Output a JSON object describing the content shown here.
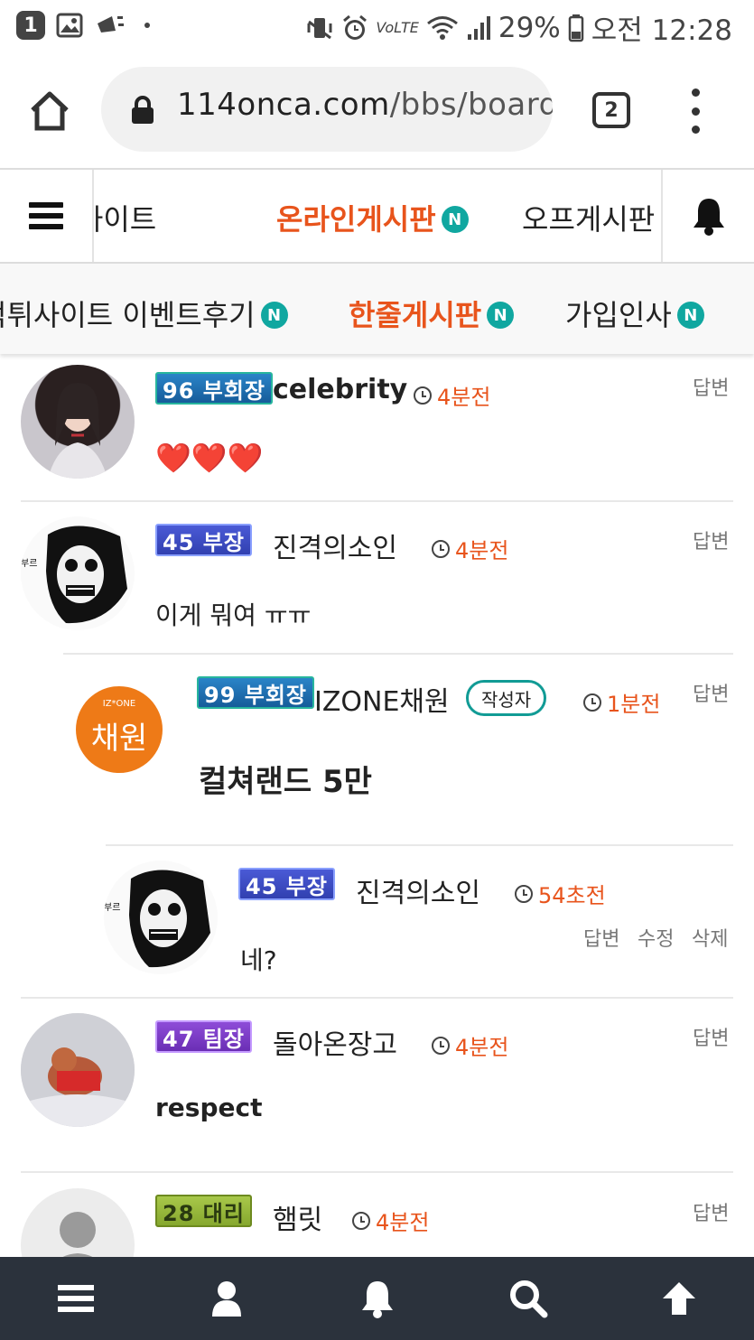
{
  "status_bar": {
    "notification_count": "1",
    "volte_label": "VoLTE",
    "battery": "29%",
    "time": "오전 12:28"
  },
  "browser": {
    "url_host": "114onca.com",
    "url_path": "/bbs/board",
    "tab_count": "2"
  },
  "nav_primary": {
    "items": [
      {
        "label": "먹튀사이트",
        "active": false,
        "new": false
      },
      {
        "label": "온라인게시판",
        "active": true,
        "new": true
      },
      {
        "label": "오프게시판",
        "active": false,
        "new": false
      }
    ],
    "new_badge": "N"
  },
  "nav_secondary": {
    "items": [
      {
        "label": "먹튀사이트 이벤트후기",
        "active": false,
        "new": true
      },
      {
        "label": "한줄게시판",
        "active": true,
        "new": true
      },
      {
        "label": "가입인사",
        "active": false,
        "new": true
      }
    ]
  },
  "comments": [
    {
      "level": "96 부회장",
      "level_color": "#1d6fae",
      "nickname": "celebrity",
      "time": "4분전",
      "text": "❤️❤️❤️",
      "reply": "답변"
    },
    {
      "level": "45 부장",
      "level_color": "#3d4fc7",
      "nickname": "진격의소인",
      "time": "4분전",
      "text": "이게 뭐여 ㅠㅠ",
      "reply": "답변"
    },
    {
      "level": "99 부회장",
      "level_color": "#1d6fae",
      "nickname": "IZONE채원",
      "author_tag": "작성자",
      "time": "1분전",
      "text": "컬쳐랜드 5만",
      "reply": "답변",
      "avatar_text": "채원",
      "avatar_sub": "IZ*ONE"
    },
    {
      "level": "45 부장",
      "level_color": "#3d4fc7",
      "nickname": "진격의소인",
      "time": "54초전",
      "text": "네?",
      "actions": [
        "답변",
        "수정",
        "삭제"
      ]
    },
    {
      "level": "47 팀장",
      "level_color": "#7e37c9",
      "nickname": "돌아온장고",
      "time": "4분전",
      "text": "respect",
      "reply": "답변"
    },
    {
      "level": "28 대리",
      "level_color": "#86b22e",
      "nickname": "햄릿",
      "time": "4분전",
      "text": "",
      "reply": "답변"
    }
  ],
  "bottom_bar": [
    "menu-icon",
    "user-icon",
    "bell-icon",
    "search-icon",
    "arrow-up-icon"
  ]
}
